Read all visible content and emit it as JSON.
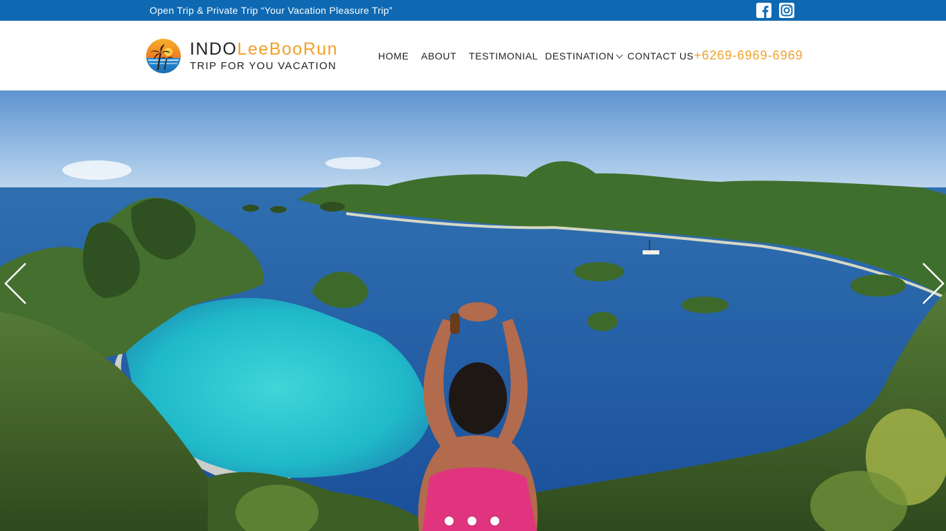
{
  "topbar": {
    "tagline": "Open Trip & Private Trip “Your Vacation Pleasure Trip”",
    "social": [
      "facebook-icon",
      "instagram-icon"
    ]
  },
  "brand": {
    "name_part1": "INDO",
    "name_part2": "LeeBooRun",
    "subtitle": "TRIP FOR YOU VACATION"
  },
  "nav": {
    "home": "HOME",
    "about": "ABOUT",
    "testimonial": "TESTIMONIAL",
    "destination": "DESTINATION",
    "contact": "CONTACT US"
  },
  "phone": "+6269-6969-6969",
  "colors": {
    "topbar": "#0e69b2",
    "accent": "#f0a02a",
    "text": "#222222"
  },
  "slider": {
    "active_index": 1,
    "slide_count": 3
  }
}
